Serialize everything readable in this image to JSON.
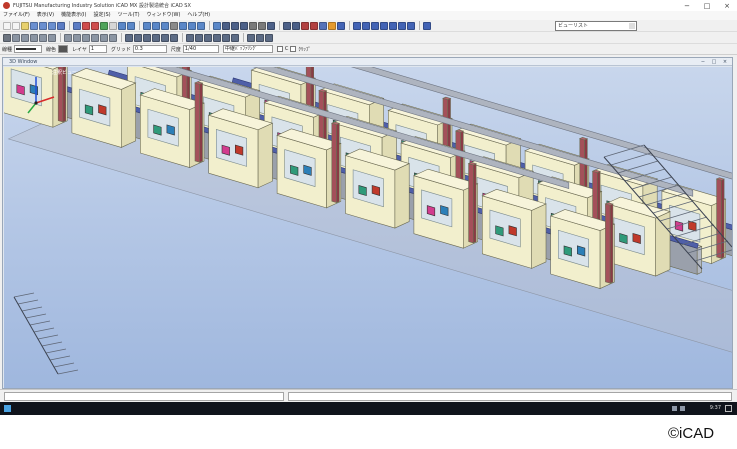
{
  "app": {
    "title": "FUJITSU Manufacturing Industry Solution iCAD MX 設計製造統合 iCAD SX",
    "window_controls": [
      "−",
      "□",
      "×"
    ]
  },
  "menu": [
    "ファイル(F)",
    "表示(V)",
    "機能表示(I)",
    "設定(S)",
    "ツール(T)",
    "ウィンドウ(W)",
    "ヘルプ(H)"
  ],
  "search": {
    "value": "ビューリスト"
  },
  "properties": {
    "line_label": "線種",
    "color_label": "線色",
    "layer_label": "レイヤ",
    "layer_value": "1",
    "grid_label": "グリッド",
    "grid_value": "0.3",
    "scale_label": "尺度",
    "scale_value": "1/40",
    "mode_value": "中継ﾊﾞｯﾌｧﾘﾝｸﾞ",
    "check1_label": "C",
    "check2_label": "ｸﾘｯﾌﾟ"
  },
  "viewport": {
    "tab_label": "3D Window",
    "view_label": "注釈ビュー"
  },
  "taskbar": {
    "clock": "9:37"
  },
  "copyright": "©iCAD",
  "colors": {
    "background_top": "#c8d6ec",
    "background_bottom": "#9fb7de",
    "machine_body": "#f2efcd",
    "machine_edge": "#6b6a52",
    "frame_grey": "#b9bcc3",
    "conveyor_blue": "#4f5fa8",
    "column_red": "#a4505a",
    "accent_pink": "#d23c8e",
    "accent_green": "#2f9a7a"
  },
  "toolbar_icon_colors_1": [
    "#f4f4f4",
    "#f4f4f4",
    "#e7d06c",
    "#6a8fd0",
    "#6a8fd0",
    "#6a8fd0",
    "#5b7cc4",
    "#5b7cc4",
    "#cf4d4d",
    "#cf4d4d",
    "#4fa35a",
    "#d6d6d6",
    "#5a87c8",
    "#5a87c8",
    "#5a87c8",
    "#5a87c8",
    "#5a87c8",
    "#8a8a8a",
    "#5a87c8",
    "#5a87c8",
    "#5a87c8",
    "#5a87c8",
    "#4b5f87",
    "#4b5f87",
    "#4b5f87",
    "#7a7a7a",
    "#7a7a7a",
    "#4b5f87",
    "#4b5f87",
    "#4b5f87",
    "#b24040",
    "#b24040",
    "#5572b8",
    "#e49a2e",
    "#4263b5",
    "#4263b5",
    "#4263b5",
    "#4263b5",
    "#4263b5",
    "#4263b5",
    "#4263b5",
    "#4263b5",
    "#4263b5"
  ],
  "toolbar_icon_colors_2": [
    "#6c7480",
    "#8b95a3",
    "#8b95a3",
    "#8b95a3",
    "#8b95a3",
    "#8b95a3",
    "#8b95a3",
    "#8b95a3",
    "#8b95a3",
    "#8b95a3",
    "#8b95a3",
    "#8b95a3",
    "#5c6b85",
    "#5c6b85",
    "#5c6b85",
    "#5c6b85",
    "#5c6b85",
    "#5c6b85",
    "#5c6b85",
    "#5c6b85",
    "#5c6b85",
    "#5c6b85",
    "#5c6b85",
    "#5c6b85",
    "#5c6b85",
    "#5c6b85",
    "#5c6b85"
  ]
}
